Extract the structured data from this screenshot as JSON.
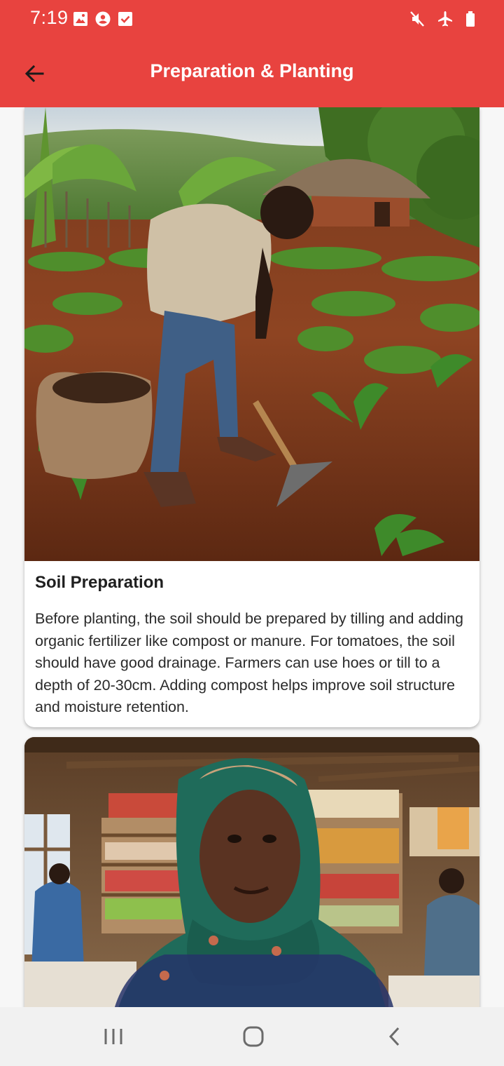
{
  "status_bar": {
    "time": "7:19",
    "left_icons": [
      "gallery-icon",
      "account-circle-icon",
      "checkbox-icon"
    ],
    "right_icons": [
      "mute-icon",
      "airplane-icon",
      "battery-icon"
    ]
  },
  "app_bar": {
    "title": "Preparation & Planting",
    "back_icon": "arrow-back-icon",
    "color": "#e8433f"
  },
  "cards": [
    {
      "title": "Soil Preparation",
      "body": "Before planting, the soil should be prepared by tilling and adding organic fertilizer like compost or manure. For tomatoes, the soil should have good drainage. Farmers can use hoes or till to a depth of 20-30cm. Adding compost helps improve soil structure and moisture retention."
    },
    {
      "title": "",
      "body": ""
    }
  ],
  "nav_bar": {
    "icons": [
      "recents-icon",
      "home-icon",
      "back-icon"
    ]
  }
}
